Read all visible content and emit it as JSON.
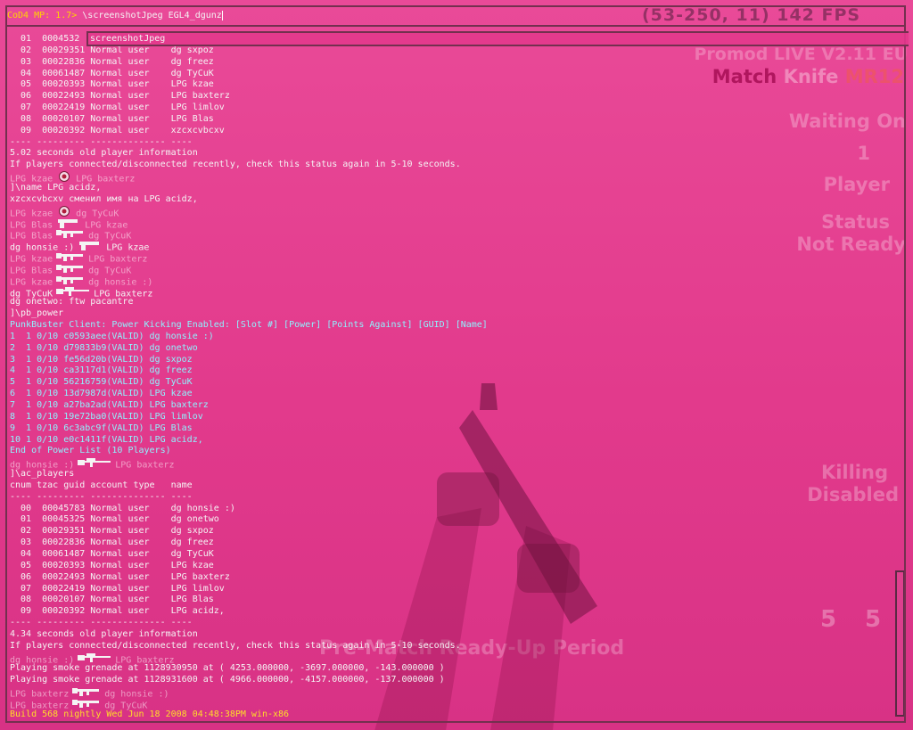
{
  "console": {
    "prompt_prefix": "CoD4 MP: 1.7>",
    "input_text": "\\screenshotJpeg EGL4_dgunz",
    "suggestion": "screenshotJpeg",
    "lines": [
      {
        "text": "  01  0004532"
      },
      {
        "text": "  02  00029351 Normal user    dg sxpoz"
      },
      {
        "text": "  03  00022836 Normal user    dg freez"
      },
      {
        "text": "  04  00061487 Normal user    dg TyCuK"
      },
      {
        "text": "  05  00020393 Normal user    LPG kzae"
      },
      {
        "text": "  06  00022493 Normal user    LPG baxterz"
      },
      {
        "text": "  07  00022419 Normal user    LPG limlov"
      },
      {
        "text": "  08  00020107 Normal user    LPG Blas"
      },
      {
        "text": "  09  00020392 Normal user    xzcxcvbcxv"
      },
      {
        "text": "---- --------- -------------- ----"
      },
      {
        "text": "5.02 seconds old player information"
      },
      {
        "text": "If players connected/disconnected recently, check this status again in 5-10 seconds."
      },
      {
        "killer": "LPG kzae",
        "icon": "headshot-icon",
        "victim": "LPG baxterz",
        "dim": true
      },
      {
        "text": "]\\name LPG acidz,"
      },
      {
        "text": "xzcxcvbcxv сменил имя на LPG acidz,"
      },
      {
        "killer": "LPG kzae",
        "icon": "headshot-icon",
        "victim": "dg TyCuK",
        "dim": true
      },
      {
        "killer": "LPG Blas",
        "icon": "pistol-icon",
        "victim": "LPG kzae",
        "dim": true
      },
      {
        "killer": "LPG Blas",
        "icon": "rifle-icon",
        "victim": "dg TyCuK",
        "dim": true
      },
      {
        "killer": "dg honsie :)",
        "icon": "pistol-icon",
        "victim": "LPG kzae",
        "dim": false
      },
      {
        "killer": "LPG kzae",
        "icon": "rifle-icon",
        "victim": "LPG baxterz",
        "dim": true
      },
      {
        "killer": "LPG Blas",
        "icon": "rifle-icon",
        "victim": "dg TyCuK",
        "dim": true
      },
      {
        "killer": "LPG kzae",
        "icon": "rifle-icon",
        "victim": "dg honsie :)",
        "dim": true
      },
      {
        "killer": "dg TyCuK",
        "icon": "sniper-icon",
        "victim": "LPG baxterz",
        "dim": false
      },
      {
        "text": "dg onetwo: ftw pacantre"
      },
      {
        "text": "]\\pb_power"
      },
      {
        "text": "PunkBuster Client: Power Kicking Enabled: [Slot #] [Power] [Points Against] [GUID] [Name]",
        "color": "cyan"
      },
      {
        "text": "1  1 0/10 c0593aee(VALID) dg honsie :)",
        "color": "cyan"
      },
      {
        "text": "2  1 0/10 d79833b9(VALID) dg onetwo",
        "color": "cyan"
      },
      {
        "text": "3  1 0/10 fe56d20b(VALID) dg sxpoz",
        "color": "cyan"
      },
      {
        "text": "4  1 0/10 ca3117d1(VALID) dg freez",
        "color": "cyan"
      },
      {
        "text": "5  1 0/10 56216759(VALID) dg TyCuK",
        "color": "cyan"
      },
      {
        "text": "6  1 0/10 13d7987d(VALID) LPG kzae",
        "color": "cyan"
      },
      {
        "text": "7  1 0/10 a27ba2ad(VALID) LPG baxterz",
        "color": "cyan"
      },
      {
        "text": "8  1 0/10 19e72ba0(VALID) LPG limlov",
        "color": "cyan"
      },
      {
        "text": "9  1 0/10 6c3abc9f(VALID) LPG Blas",
        "color": "cyan"
      },
      {
        "text": "10 1 0/10 e0c1411f(VALID) LPG acidz,",
        "color": "cyan"
      },
      {
        "text": "End of Power List (10 Players)",
        "color": "cyan"
      },
      {
        "killer": "dg honsie :)",
        "icon": "sniper-icon",
        "victim": "LPG baxterz",
        "dim": true
      },
      {
        "text": "]\\ac_players"
      },
      {
        "text": "cnum tzac guid account type   name"
      },
      {
        "text": "---- --------- -------------- ----"
      },
      {
        "text": "  00  00045783 Normal user    dg honsie :)"
      },
      {
        "text": "  01  00045325 Normal user    dg onetwo"
      },
      {
        "text": "  02  00029351 Normal user    dg sxpoz"
      },
      {
        "text": "  03  00022836 Normal user    dg freez"
      },
      {
        "text": "  04  00061487 Normal user    dg TyCuK"
      },
      {
        "text": "  05  00020393 Normal user    LPG kzae"
      },
      {
        "text": "  06  00022493 Normal user    LPG baxterz"
      },
      {
        "text": "  07  00022419 Normal user    LPG limlov"
      },
      {
        "text": "  08  00020107 Normal user    LPG Blas"
      },
      {
        "text": "  09  00020392 Normal user    LPG acidz,"
      },
      {
        "text": "---- --------- -------------- ----"
      },
      {
        "text": "4.34 seconds old player information"
      },
      {
        "text": "If players connected/disconnected recently, check this status again in 5-10 seconds."
      },
      {
        "killer": "dg honsie :)",
        "icon": "sniper-icon",
        "victim": "LPG baxterz",
        "dim": true
      },
      {
        "text": "Playing smoke grenade at 1128930950 at ( 4253.000000, -3697.000000, -143.000000 )"
      },
      {
        "text": "Playing smoke grenade at 1128931600 at ( 4966.000000, -4157.000000, -137.000000 )"
      },
      {
        "killer": "LPG baxterz",
        "icon": "rifle-icon",
        "victim": "dg honsie :)",
        "dim": true
      },
      {
        "killer": "LPG baxterz",
        "icon": "rifle-icon",
        "victim": "dg TyCuK",
        "dim": true
      },
      {
        "text": "Build 568 nightly Wed Jun 18 2008 04:48:38PM win-x86",
        "color": "yellow"
      }
    ]
  },
  "hud": {
    "fps": "(53-250, 11) 142 FPS",
    "mod_name": "Promod LIVE V2.11 EU",
    "match_label": "Match",
    "knife_label": "Knife",
    "mr_label": "MR12",
    "waiting_label": "Waiting On",
    "waiting_count": "1",
    "player_label": "Player",
    "status_label": "Status",
    "not_ready_label": "Not Ready",
    "killing_label": "Killing",
    "disabled_label": "Disabled",
    "pre_match": "Pre-Match Ready-Up Period",
    "score_left": "5",
    "score_right": "5"
  },
  "colors": {
    "console_bg": "#e3388c",
    "border": "#73304f",
    "prompt": "#ffd400",
    "cyan_text": "#8ef3ff",
    "build_text": "#ffde28"
  }
}
